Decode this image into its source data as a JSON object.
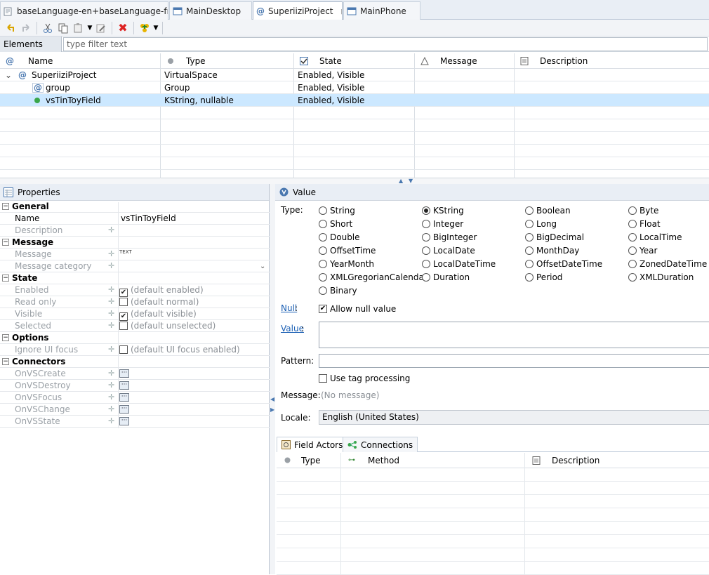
{
  "tabs": [
    {
      "label": "baseLanguage-en+baseLanguage-fr",
      "icon": "language-icon",
      "active": false
    },
    {
      "label": "MainDesktop",
      "icon": "window-icon",
      "active": false
    },
    {
      "label": "SuperiiziProject",
      "icon": "virtual-space-icon",
      "active": true,
      "close": "⊠"
    },
    {
      "label": "MainPhone",
      "icon": "window-icon",
      "active": false
    }
  ],
  "toolbar": {
    "icons": [
      "undo-icon",
      "redo-icon",
      "cut-icon",
      "copy-icon",
      "paste-icon",
      "edit-icon",
      "delete-icon",
      "add-icon"
    ]
  },
  "filter": {
    "label": "Elements filter",
    "placeholder": "type filter text"
  },
  "tree": {
    "columns": [
      "Name",
      "Type",
      "State",
      "Message",
      "Description"
    ],
    "rows": [
      {
        "name": "SuperiiziProject",
        "type": "VirtualSpace",
        "state": "Enabled, Visible",
        "selected": false
      },
      {
        "name": "group",
        "type": "Group",
        "state": "Enabled, Visible",
        "selected": false
      },
      {
        "name": "vsTinToyField",
        "type": "KString, nullable",
        "state": "Enabled, Visible",
        "selected": true
      }
    ]
  },
  "properties": {
    "title": "Properties",
    "groups": {
      "general": "General",
      "message": "Message",
      "state": "State",
      "options": "Options",
      "connectors": "Connectors"
    },
    "name_label": "Name",
    "name_value": "vsTinToyField",
    "description_label": "Description",
    "message_label": "Message",
    "message_badge": "TEXT",
    "message_category_label": "Message category",
    "enabled_label": "Enabled",
    "enabled_value": "(default enabled)",
    "readonly_label": "Read only",
    "readonly_value": "(default normal)",
    "visible_label": "Visible",
    "visible_value": "(default visible)",
    "selected_label": "Selected",
    "selected_value": "(default unselected)",
    "ignore_focus_label": "Ignore UI focus",
    "ignore_focus_value": "(default UI focus enabled)",
    "connectors": [
      "OnVSCreate",
      "OnVSDestroy",
      "OnVSFocus",
      "OnVSChange",
      "OnVSState"
    ]
  },
  "value_panel": {
    "title": "Value",
    "type_label": "Type:",
    "types": [
      [
        "String",
        "KString",
        "Boolean",
        "Byte"
      ],
      [
        "Short",
        "Integer",
        "Long",
        "Float"
      ],
      [
        "Double",
        "BigInteger",
        "BigDecimal",
        "LocalTime"
      ],
      [
        "OffsetTime",
        "LocalDate",
        "MonthDay",
        "Year"
      ],
      [
        "YearMonth",
        "LocalDateTime",
        "OffsetDateTime",
        "ZonedDateTime"
      ],
      [
        "XMLGregorianCalendar",
        "Duration",
        "Period",
        "XMLDuration"
      ],
      [
        "Binary"
      ]
    ],
    "selected_type": "KString",
    "null_label": "Null",
    "null_check_label": "Allow null value",
    "value_label": "Value",
    "pattern_label": "Pattern:",
    "tag_processing_label": "Use tag processing",
    "message_label": "Message:",
    "message_value": "(No message)",
    "locale_label": "Locale:",
    "locale_value": "English (United States)"
  },
  "field_actors": {
    "tabs": [
      "Field Actors",
      "Connections"
    ],
    "columns": [
      "Type",
      "Method",
      "Description"
    ]
  }
}
